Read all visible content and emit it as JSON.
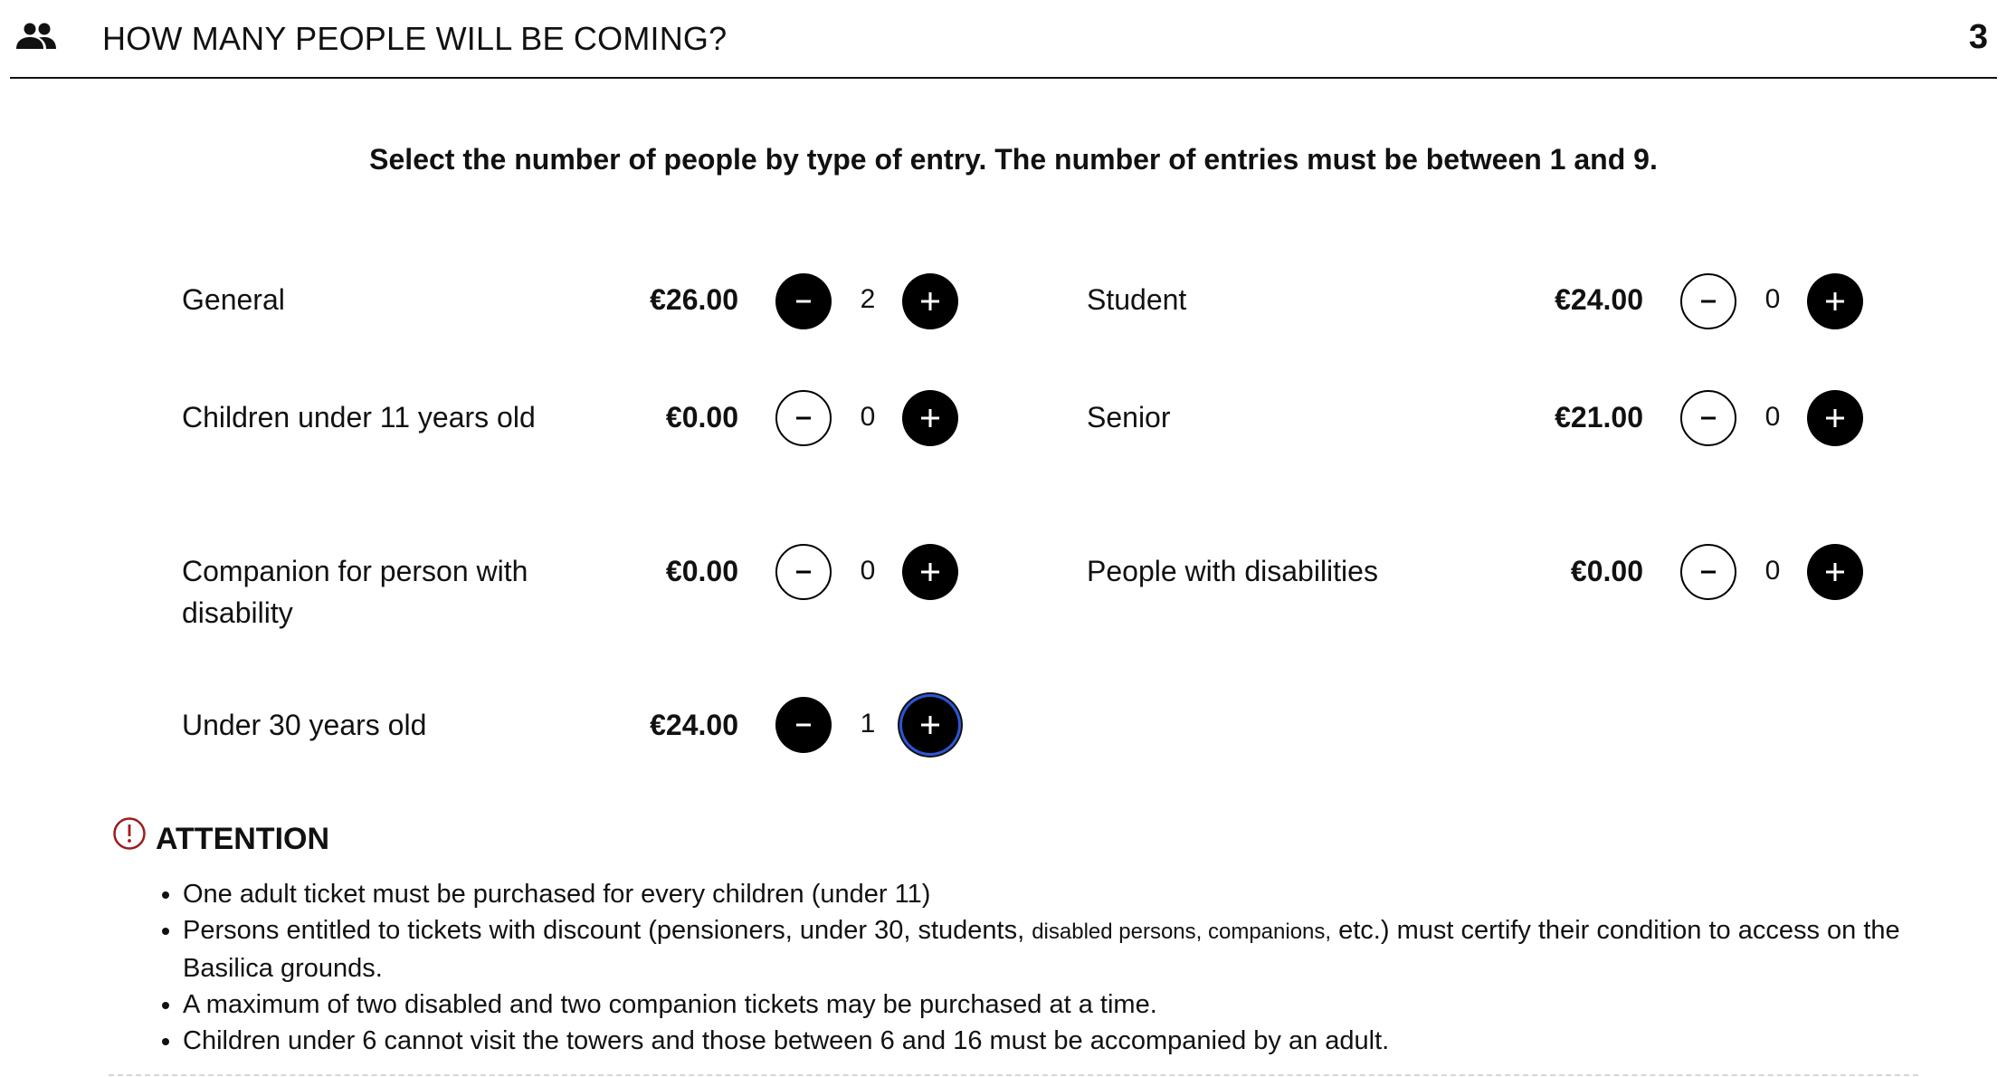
{
  "header": {
    "title": "HOW MANY PEOPLE WILL BE COMING?",
    "step": "3",
    "icon": "people-icon"
  },
  "instruction": "Select the number of people by type of entry. The number of entries must be between 1 and 9.",
  "tickets": {
    "general": {
      "label": "General",
      "price": "€26.00",
      "qty": "2"
    },
    "student": {
      "label": "Student",
      "price": "€24.00",
      "qty": "0"
    },
    "children": {
      "label": "Children under 11 years old",
      "price": "€0.00",
      "qty": "0"
    },
    "senior": {
      "label": "Senior",
      "price": "€21.00",
      "qty": "0"
    },
    "companion": {
      "label": "Companion for person with disability",
      "price": "€0.00",
      "qty": "0"
    },
    "disabilities": {
      "label": "People with disabilities",
      "price": "€0.00",
      "qty": "0"
    },
    "under30": {
      "label": "Under 30 years old",
      "price": "€24.00",
      "qty": "1"
    }
  },
  "attention": {
    "heading": "ATTENTION",
    "icon": "warning-circle-icon",
    "icon_color": "#9e1b1b",
    "notes": {
      "n1": "One adult ticket must be purchased for every children (under 11)",
      "n2_start": "Persons entitled to tickets with discount (pensioners, under 30, students, ",
      "n2_small": "disabled persons, companions,",
      "n2_end": " etc.) must certify their condition to access on the Basilica grounds.",
      "n3": "A maximum of two disabled and two companion tickets may be purchased at a time.",
      "n4": "Children under 6 cannot visit the towers and those between 6 and 16 must be accompanied by an adult."
    }
  },
  "colors": {
    "button_fill": "#000000",
    "focus_ring": "#2b56d6",
    "text": "#111111"
  }
}
